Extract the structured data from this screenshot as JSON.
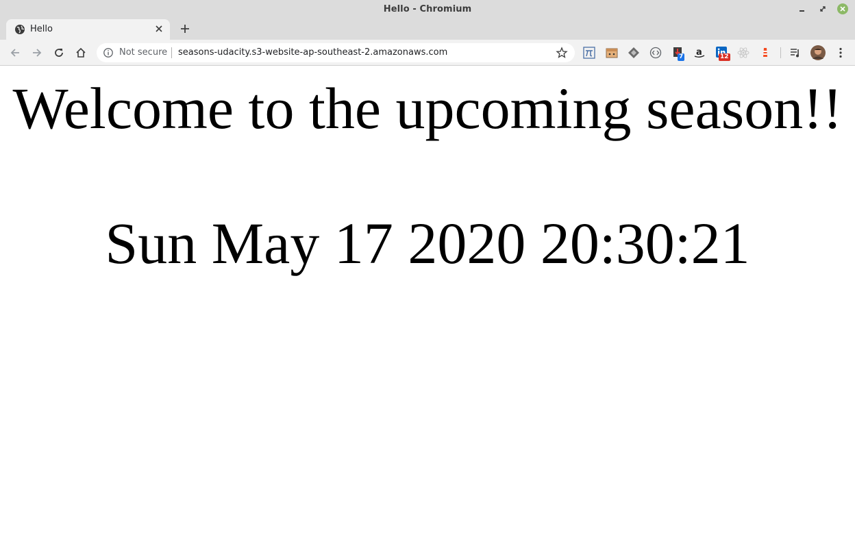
{
  "window": {
    "title": "Hello - Chromium"
  },
  "tabs": [
    {
      "label": "Hello",
      "icon": "globe-icon"
    }
  ],
  "toolbar": {
    "security_label": "Not secure",
    "url": "seasons-udacity.s3-website-ap-southeast-2.amazonaws.com",
    "extensions": [
      {
        "icon": "pi-extension-icon"
      },
      {
        "icon": "box-extension-icon"
      },
      {
        "icon": "diamond-extension-icon"
      },
      {
        "icon": "code-extension-icon"
      },
      {
        "icon": "download-extension-icon",
        "badge": "7",
        "badge_color": "#1a73e8"
      },
      {
        "icon": "amazon-icon"
      },
      {
        "icon": "linkedin-icon",
        "badge": "12",
        "badge_color": "#d93025"
      },
      {
        "icon": "react-icon"
      },
      {
        "icon": "lighthouse-icon"
      }
    ]
  },
  "page": {
    "heading": "Welcome to the upcoming season!!",
    "datetime": "Sun May 17 2020 20:30:21"
  },
  "colors": {
    "titlebar": "#dcdcdc",
    "toolbar": "#f2f2f2",
    "close_button": "#8cb966"
  }
}
